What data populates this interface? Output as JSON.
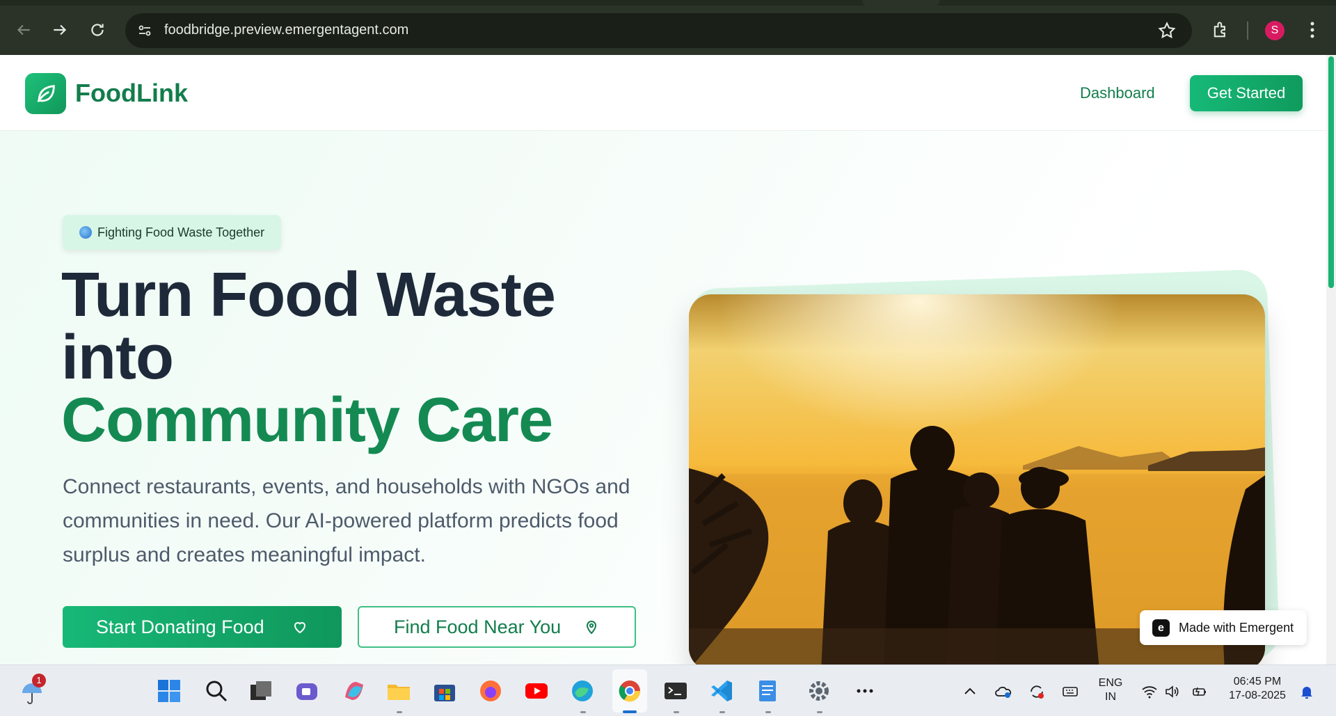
{
  "browser": {
    "url": "foodbridge.preview.emergentagent.com",
    "profile_initial": "S"
  },
  "header": {
    "brand": "FoodLink",
    "nav_dashboard": "Dashboard",
    "cta": "Get Started"
  },
  "hero": {
    "tag": "Fighting Food Waste Together",
    "headline_line1": "Turn Food Waste",
    "headline_line2": "into",
    "headline_line3": "Community Care",
    "subtitle": "Connect restaurants, events, and households with NGOs and communities in need. Our AI-powered platform predicts food surplus and creates meaningful impact.",
    "primary_button": "Start Donating Food",
    "secondary_button": "Find Food Near You"
  },
  "badge": {
    "label": "Made with Emergent"
  },
  "taskbar": {
    "notification_count": "1",
    "lang_line1": "ENG",
    "lang_line2": "IN",
    "time": "06:45 PM",
    "date": "17-08-2025"
  },
  "colors": {
    "brand_green": "#137d4c",
    "accent_green": "#16b978",
    "headline_dark": "#1e2a3a"
  }
}
